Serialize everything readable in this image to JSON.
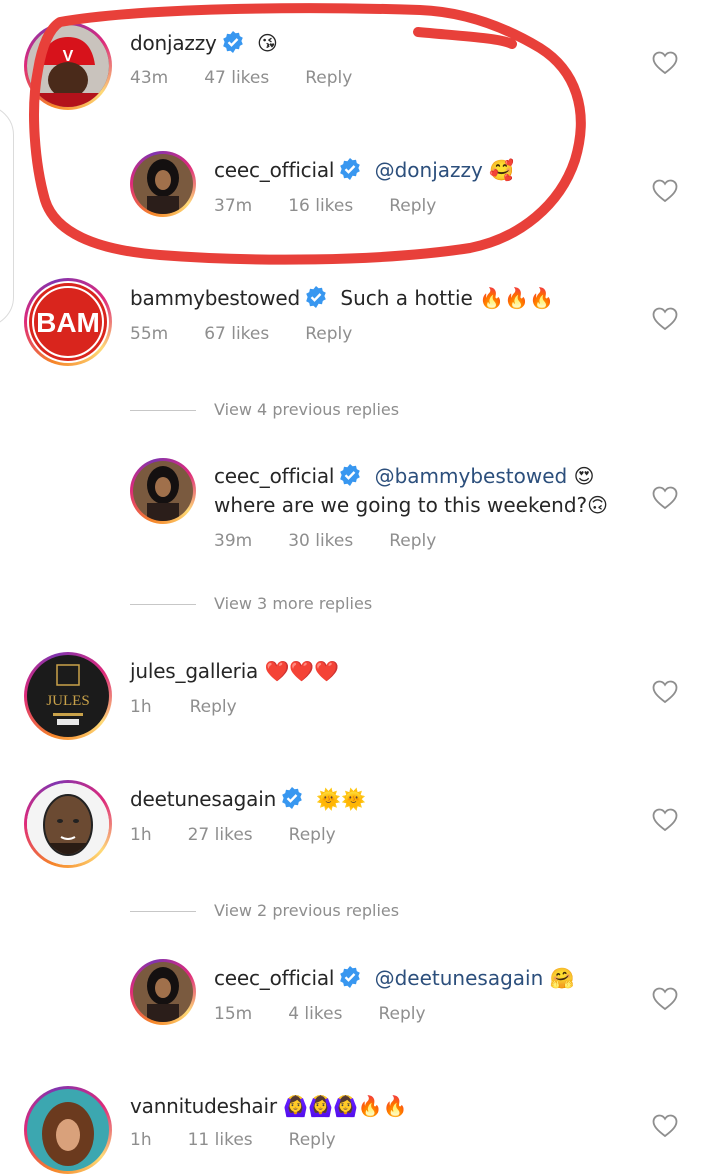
{
  "comments": [
    {
      "username": "donjazzy",
      "verified": true,
      "text": "😘",
      "mention": "",
      "time": "43m",
      "likes": "47 likes",
      "reply": "Reply",
      "avatar": "donjazzy-avatar"
    },
    {
      "username": "ceec_official",
      "verified": true,
      "text": "🥰",
      "mention": "@donjazzy",
      "time": "37m",
      "likes": "16 likes",
      "reply": "Reply",
      "avatar": "ceec-avatar"
    },
    {
      "username": "bammybestowed",
      "verified": true,
      "text": "Such a hottie 🔥🔥🔥",
      "mention": "",
      "time": "55m",
      "likes": "67 likes",
      "reply": "Reply",
      "avatar": "bam-avatar",
      "avatar_text": "BAM"
    },
    {
      "username": "ceec_official",
      "verified": true,
      "mention": "@bammybestowed",
      "text": "😍",
      "text2": "where are we going to this weekend?🙃",
      "time": "39m",
      "likes": "30 likes",
      "reply": "Reply",
      "avatar": "ceec-avatar"
    },
    {
      "username": "jules_galleria",
      "verified": false,
      "text": "❤️❤️❤️",
      "mention": "",
      "time": "1h",
      "likes": "",
      "reply": "Reply",
      "avatar": "jules-avatar",
      "avatar_text": "JULES"
    },
    {
      "username": "deetunesagain",
      "verified": true,
      "text": "🌞🌞",
      "mention": "",
      "time": "1h",
      "likes": "27 likes",
      "reply": "Reply",
      "avatar": "deetunes-avatar"
    },
    {
      "username": "ceec_official",
      "verified": true,
      "mention": "@deetunesagain",
      "text": "🤗",
      "time": "15m",
      "likes": "4 likes",
      "reply": "Reply",
      "avatar": "ceec-avatar"
    },
    {
      "username": "vannitudeshair",
      "verified": false,
      "text": "🙆‍♀️🙆‍♀️🙆‍♀️🔥🔥",
      "mention": "",
      "time": "1h",
      "likes": "11 likes",
      "reply": "Reply",
      "avatar": "vannitudes-avatar"
    }
  ],
  "view_replies": [
    "View 4 previous replies",
    "View 3 more replies",
    "View 2 previous replies"
  ],
  "colors": {
    "annotation": "#e8403a",
    "verified": "#3897f0",
    "mention": "#2c4f7c",
    "meta": "#8e8e8e"
  }
}
